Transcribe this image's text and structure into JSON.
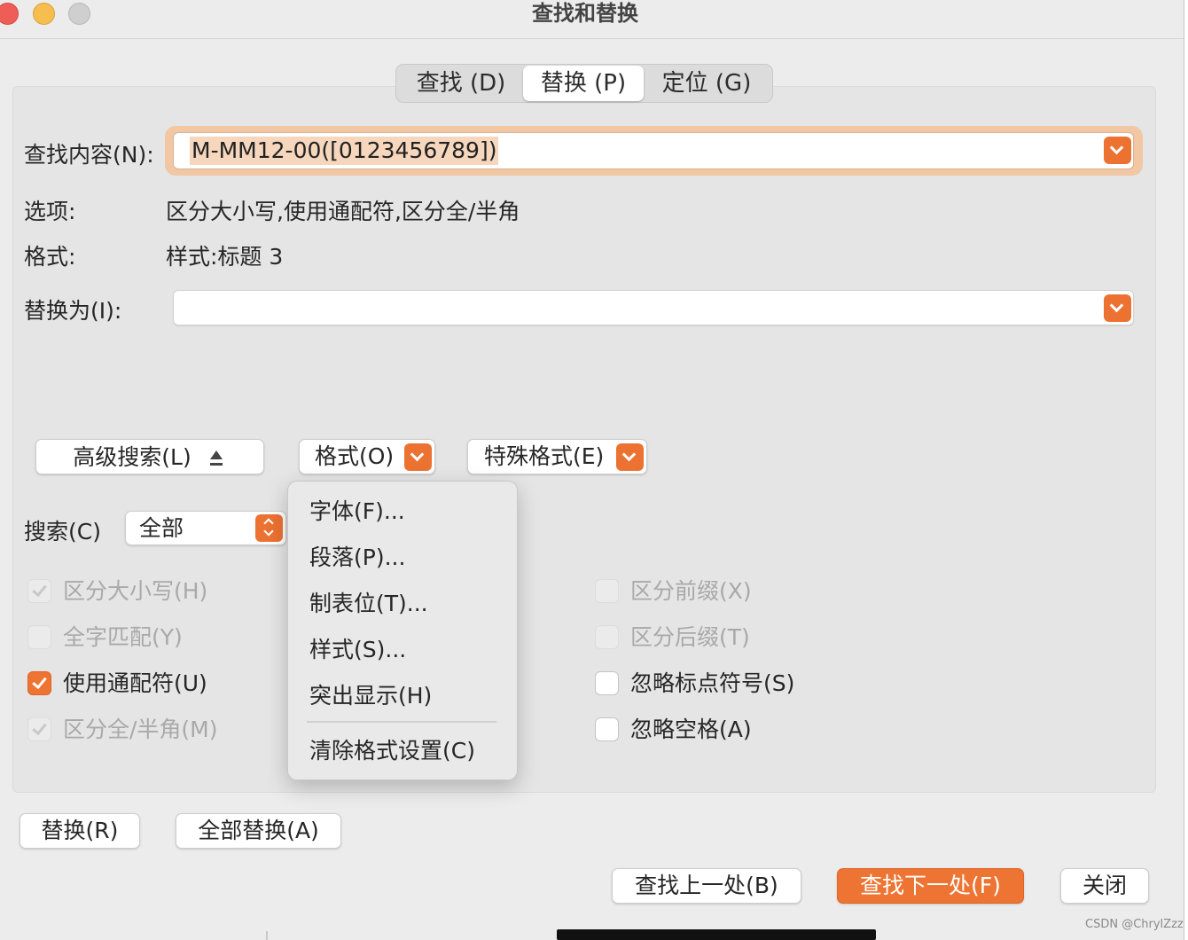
{
  "window": {
    "title": "查找和替换"
  },
  "tabs": [
    {
      "label": "查找 (D)",
      "selected": false
    },
    {
      "label": "替换 (P)",
      "selected": true
    },
    {
      "label": "定位 (G)",
      "selected": false
    }
  ],
  "find": {
    "label": "查找内容(N):",
    "value": "M-MM12-00([0123456789])"
  },
  "options": {
    "label": "选项:",
    "value": "区分大小写,使用通配符,区分全/半角"
  },
  "format": {
    "label": "格式:",
    "value": "样式:标题 3"
  },
  "replace": {
    "label": "替换为(I):",
    "value": ""
  },
  "buttons": {
    "advanced": "高级搜索(L)",
    "format": "格式(O)",
    "special": "特殊格式(E)",
    "replace": "替换(R)",
    "replace_all": "全部替换(A)",
    "find_prev": "查找上一处(B)",
    "find_next": "查找下一处(F)",
    "close": "关闭"
  },
  "search": {
    "label": "搜索(C)",
    "value": "全部"
  },
  "checkboxes": {
    "match_case": {
      "label": "区分大小写(H)",
      "checked": true,
      "enabled": false
    },
    "whole_word": {
      "label": "全字匹配(Y)",
      "checked": false,
      "enabled": false
    },
    "wildcards": {
      "label": "使用通配符(U)",
      "checked": true,
      "enabled": true
    },
    "full_half_width": {
      "label": "区分全/半角(M)",
      "checked": true,
      "enabled": false
    },
    "match_prefix": {
      "label": "区分前缀(X)",
      "checked": false,
      "enabled": false
    },
    "match_suffix": {
      "label": "区分后缀(T)",
      "checked": false,
      "enabled": false
    },
    "ignore_punctuation": {
      "label": "忽略标点符号(S)",
      "checked": false,
      "enabled": true
    },
    "ignore_space": {
      "label": "忽略空格(A)",
      "checked": false,
      "enabled": true
    }
  },
  "format_menu": {
    "items": [
      "字体(F)...",
      "段落(P)...",
      "制表位(T)...",
      "样式(S)...",
      "突出显示(H)"
    ],
    "clear": "清除格式设置(C)"
  },
  "watermark": "CSDN @ChrylZzz",
  "colors": {
    "accent": "#ee7433",
    "panel": "#e5e5e5",
    "window": "#ececec"
  }
}
